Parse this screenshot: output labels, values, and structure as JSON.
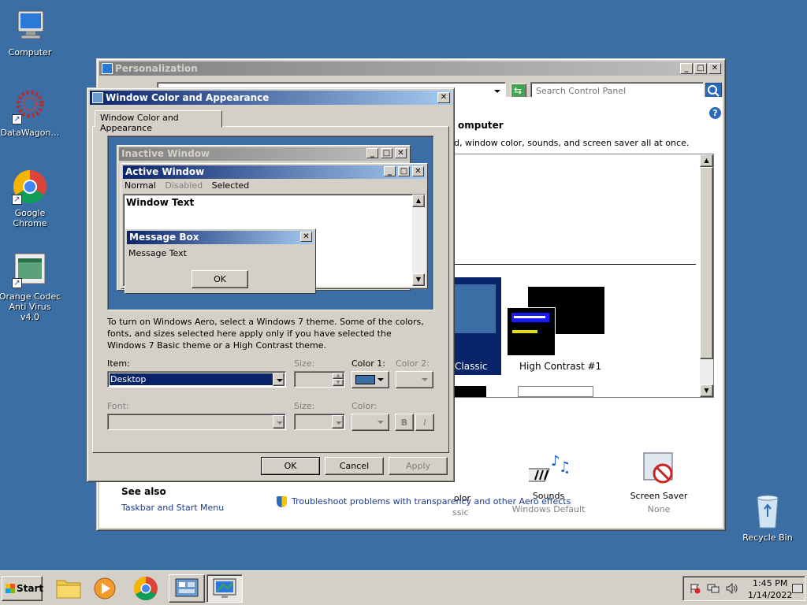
{
  "desktop": {
    "icons": [
      {
        "label": "Computer",
        "icon": "computer-icon"
      },
      {
        "label": "DataWagon…",
        "icon": "datawagon-icon"
      },
      {
        "label": "Google Chrome",
        "icon": "chrome-icon"
      },
      {
        "label": "Orange Codec Anti Virus v4.0",
        "icon": "antivirus-icon"
      },
      {
        "label": "Recycle Bin",
        "icon": "recycle-bin-icon"
      }
    ]
  },
  "personalization": {
    "title": "Personalization",
    "search_placeholder": "Search Control Panel",
    "heading_fragment": "omputer",
    "desc_fragment": "d, window color, sounds, and screen saver all at once.",
    "themes": [
      {
        "label": "Classic"
      },
      {
        "label": "High Contrast #1"
      }
    ],
    "bottom_items": [
      {
        "label": "olor",
        "sub": "ssic"
      },
      {
        "label": "Sounds",
        "sub": "Windows Default"
      },
      {
        "label": "Screen Saver",
        "sub": "None"
      }
    ],
    "see_also": {
      "heading": "See also",
      "link": "Taskbar and Start Menu"
    },
    "troubleshoot_link": "Troubleshoot problems with transparency and other Aero effects"
  },
  "dialog": {
    "title": "Window Color and Appearance",
    "tab": "Window Color and Appearance",
    "preview": {
      "inactive_title": "Inactive Window",
      "active_title": "Active Window",
      "menu": [
        "Normal",
        "Disabled",
        "Selected"
      ],
      "window_text": "Window Text",
      "msgbox_title": "Message Box",
      "msgbox_text": "Message Text",
      "msgbox_ok": "OK"
    },
    "info_text": "To turn on Windows Aero, select a Windows 7 theme.  Some of the colors, fonts, and sizes selected here apply only if you have selected the Windows 7 Basic theme or a High Contrast theme.",
    "labels": {
      "item": "Item:",
      "size": "Size:",
      "color1": "Color 1:",
      "color2": "Color 2:",
      "font": "Font:",
      "size2": "Size:",
      "color": "Color:",
      "bold": "B",
      "italic": "I"
    },
    "item_value": "Desktop",
    "color1_swatch": "#3a6ea5",
    "buttons": {
      "ok": "OK",
      "cancel": "Cancel",
      "apply": "Apply"
    }
  },
  "taskbar": {
    "start": "Start",
    "time": "1:45 PM",
    "date": "1/14/2022"
  }
}
